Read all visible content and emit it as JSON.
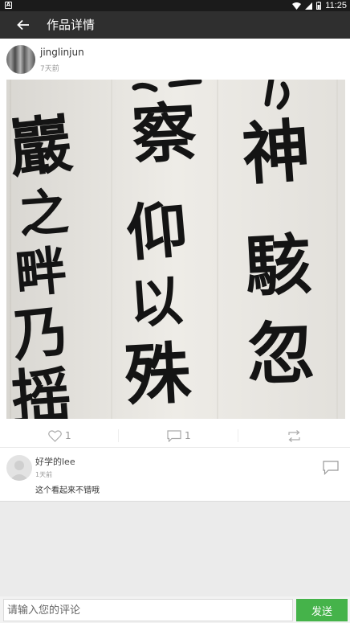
{
  "status_bar": {
    "time": "11:25"
  },
  "header": {
    "title": "作品详情"
  },
  "post": {
    "author": "jinglinjun",
    "time_ago": "7天前",
    "artwork_characters": [
      "巖",
      "之",
      "畔",
      "乃",
      "摇",
      "察",
      "仰",
      "以",
      "殊",
      "神",
      "駭",
      "忽"
    ]
  },
  "actions": {
    "likes": "1",
    "comments": "1"
  },
  "comments": [
    {
      "user": "好学的lee",
      "time_ago": "1天前",
      "text": "这个看起来不错哦"
    }
  ],
  "input": {
    "placeholder": "请输入您的评论"
  },
  "send": {
    "label": "发送"
  },
  "colors": {
    "accent": "#45b34a",
    "app_bar": "#2f2f2f"
  }
}
